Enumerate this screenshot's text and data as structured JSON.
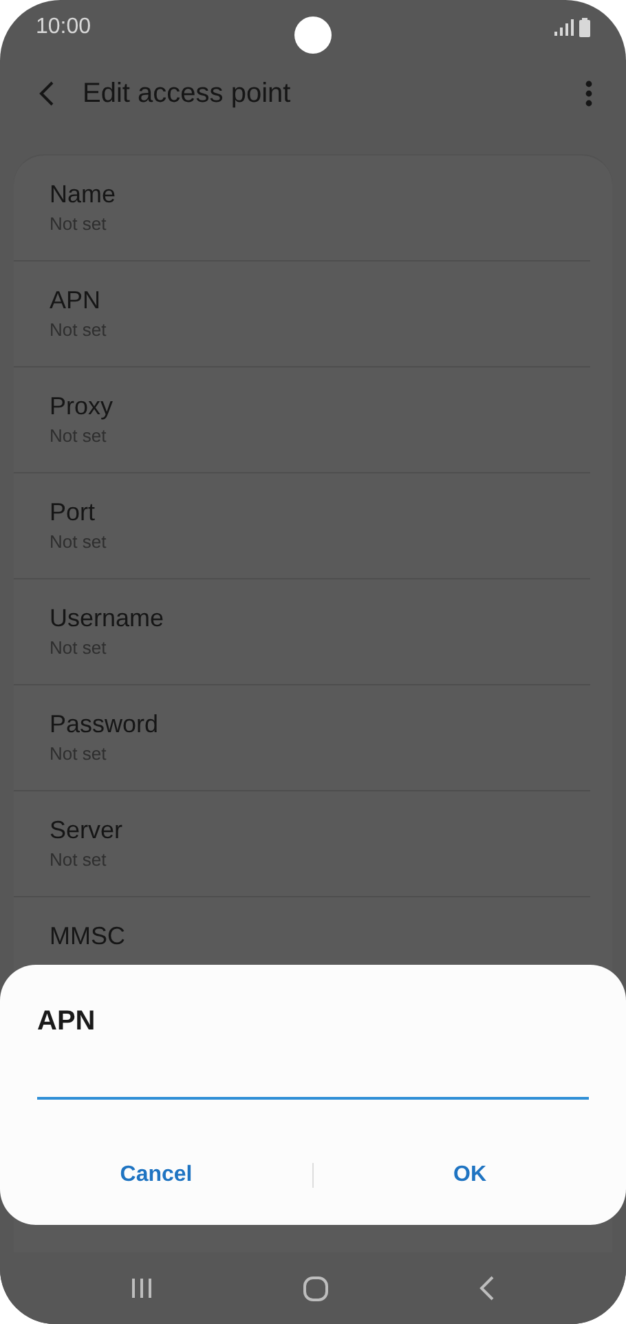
{
  "status_bar": {
    "time": "10:00"
  },
  "app_bar": {
    "title": "Edit access point"
  },
  "settings": [
    {
      "label": "Name",
      "value": "Not set"
    },
    {
      "label": "APN",
      "value": "Not set"
    },
    {
      "label": "Proxy",
      "value": "Not set"
    },
    {
      "label": "Port",
      "value": "Not set"
    },
    {
      "label": "Username",
      "value": "Not set"
    },
    {
      "label": "Password",
      "value": "Not set"
    },
    {
      "label": "Server",
      "value": "Not set"
    },
    {
      "label": "MMSC"
    }
  ],
  "dialog": {
    "title": "APN",
    "buttons": [
      "Cancel",
      "OK"
    ]
  }
}
